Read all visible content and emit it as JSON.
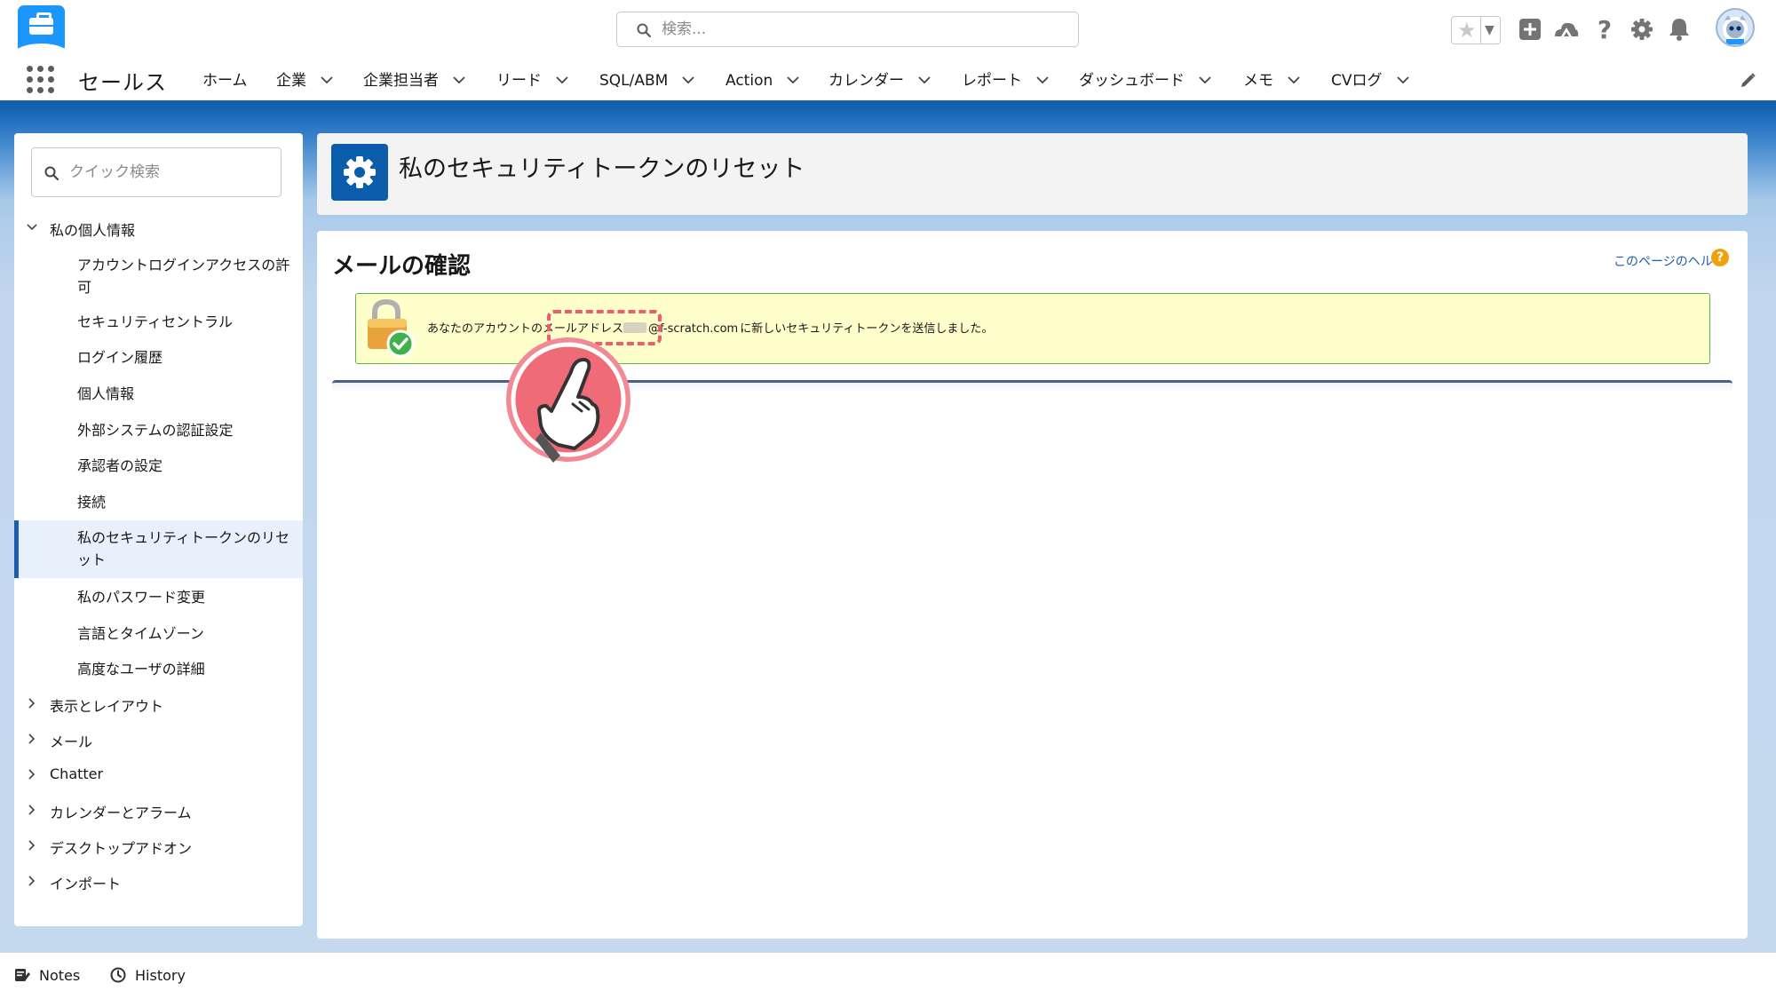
{
  "header": {
    "search_placeholder": "検索...",
    "app_name": "セールス"
  },
  "nav": {
    "items": [
      {
        "label": "ホーム",
        "has_menu": false
      },
      {
        "label": "企業",
        "has_menu": true
      },
      {
        "label": "企業担当者",
        "has_menu": true
      },
      {
        "label": "リード",
        "has_menu": true
      },
      {
        "label": "SQL/ABM",
        "has_menu": true
      },
      {
        "label": "Action",
        "has_menu": true
      },
      {
        "label": "カレンダー",
        "has_menu": true
      },
      {
        "label": "レポート",
        "has_menu": true
      },
      {
        "label": "ダッシュボード",
        "has_menu": true
      },
      {
        "label": "メモ",
        "has_menu": true
      },
      {
        "label": "CVログ",
        "has_menu": true
      }
    ]
  },
  "sidebar": {
    "quick_find_placeholder": "クイック検索",
    "expanded_section": "私の個人情報",
    "items": [
      "アカウントログインアクセスの許可",
      "セキュリティセントラル",
      "ログイン履歴",
      "個人情報",
      "外部システムの認証設定",
      "承認者の設定",
      "接続",
      "私のセキュリティトークンのリセット",
      "私のパスワード変更",
      "言語とタイムゾーン",
      "高度なユーザの詳細"
    ],
    "active_item": "私のセキュリティトークンのリセット",
    "collapsed_sections": [
      "表示とレイアウト",
      "メール",
      "Chatter",
      "カレンダーとアラーム",
      "デスクトップアドオン",
      "インポート"
    ]
  },
  "page": {
    "title": "私のセキュリティトークンのリセット",
    "section_title": "メールの確認",
    "help_link": "このページのヘルプ",
    "message_prefix": "あなたのアカウントのメールアドレス",
    "message_email": "@f-scratch.com",
    "message_suffix": "に新しいセキュリティトークンを送信しました。"
  },
  "utility_bar": {
    "notes": "Notes",
    "history": "History"
  },
  "colors": {
    "brand_blue": "#0b5cab",
    "accent_blue": "#1b96ff",
    "success_border": "#61b34f",
    "message_bg": "#ffffcc",
    "highlight_red": "#ee5c6d",
    "help_orange": "#f0a20d"
  },
  "icons": {
    "app_logo": "briefcase-cloud-icon",
    "search": "search-icon",
    "favorite": "star-icon",
    "add": "plus-icon",
    "trailhead": "trailhead-icon",
    "help": "question-icon",
    "setup": "gear-icon",
    "notifications": "bell-icon",
    "avatar": "astro-avatar",
    "edit_nav": "pencil-icon",
    "page_icon": "gear-icon",
    "message_icon": "lock-check-icon",
    "pointer": "hand-pointer-icon"
  }
}
